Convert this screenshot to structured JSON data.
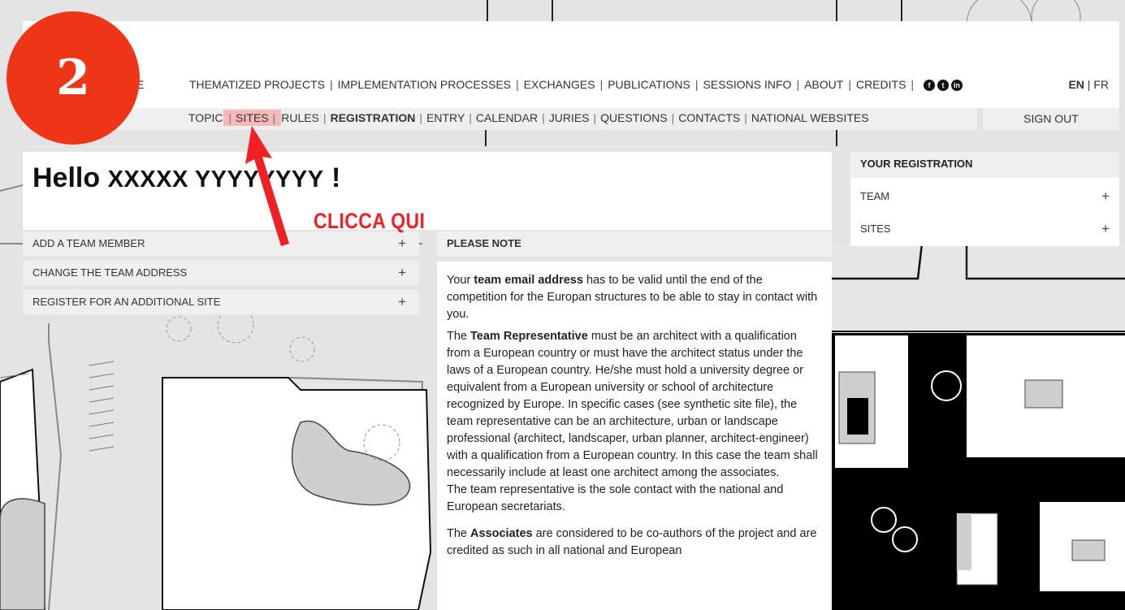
{
  "header": {
    "brand_fragment": "E",
    "nav": [
      "THEMATIZED PROJECTS",
      "IMPLEMENTATION PROCESSES",
      "EXCHANGES",
      "PUBLICATIONS",
      "SESSIONS INFO",
      "ABOUT",
      "CREDITS"
    ],
    "social_icons": [
      "facebook-icon",
      "twitter-icon",
      "linkedin-icon"
    ],
    "lang_active": "EN",
    "lang_sep": "|",
    "lang_other": "FR"
  },
  "subnav": {
    "items": [
      "TOPIC",
      "SITES",
      "RULES",
      "REGISTRATION",
      "ENTRY",
      "CALENDAR",
      "JURIES",
      "QUESTIONS",
      "CONTACTS",
      "NATIONAL WEBSITES"
    ],
    "active": "REGISTRATION",
    "highlighted": "SITES",
    "signout": "SIGN OUT"
  },
  "badge": {
    "number": "2",
    "color": "#ee3517"
  },
  "annotation": {
    "text": "CLICCA QUI",
    "color": "#ef2124"
  },
  "greeting": {
    "hello": "Hello",
    "name": "XXXXX YYYYYYYY",
    "exclaim": "!"
  },
  "actions": [
    {
      "label": "ADD A TEAM MEMBER",
      "icon": "+"
    },
    {
      "label": "CHANGE THE TEAM ADDRESS",
      "icon": "+"
    },
    {
      "label": "REGISTER FOR AN ADDITIONAL SITE",
      "icon": "+"
    }
  ],
  "note": {
    "title": "PLEASE NOTE",
    "p1_a": "Your ",
    "p1_b": "team email address",
    "p1_c": " has to be valid until the end of the competition for the Europan structures to be able to stay in contact with you.",
    "p2_a": "The ",
    "p2_b": "Team Representative",
    "p2_c": " must be an architect with a qualification from a European country or must have the architect status under the laws of a European country. He/she must hold a university degree or equivalent from a European university or school of architecture recognized by Europe. In specific cases (see synthetic site file), the team representative can be an architecture, urban or landscape professional (architect, landscaper, urban planner, architect-engineer) with a qualification from a European country. In this case the team shall necessarily include at least one architect among the associates.",
    "p2_d": "The team representative is the sole contact with the national and European secretariats.",
    "p3_a": "The ",
    "p3_b": "Associates",
    "p3_c": " are considered to be co-authors of the project and are credited as such in all national and European"
  },
  "registration_panel": {
    "title": "YOUR REGISTRATION",
    "items": [
      {
        "label": "TEAM",
        "icon": "+"
      },
      {
        "label": "SITES",
        "icon": "+"
      }
    ]
  }
}
